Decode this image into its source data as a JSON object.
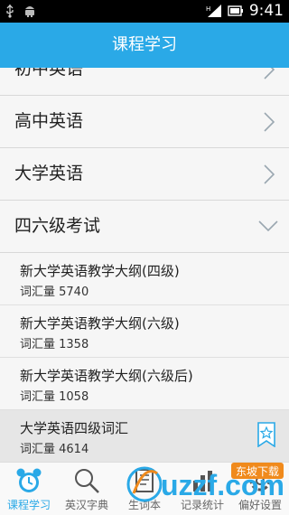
{
  "status_bar": {
    "time": "9:41"
  },
  "header": {
    "title": "课程学习"
  },
  "categories": [
    {
      "label": "初中英语",
      "state": "collapsed"
    },
    {
      "label": "高中英语",
      "state": "collapsed"
    },
    {
      "label": "大学英语",
      "state": "collapsed"
    },
    {
      "label": "四六级考试",
      "state": "expanded"
    }
  ],
  "sublist": [
    {
      "title": "新大学英语教学大纲(四级)",
      "count": "词汇量 5740"
    },
    {
      "title": "新大学英语教学大纲(六级)",
      "count": "词汇量 1358"
    },
    {
      "title": "新大学英语教学大纲(六级后)",
      "count": "词汇量 1058"
    },
    {
      "title": "大学英语四级词汇",
      "count": "词汇量 4614",
      "selected": true
    }
  ],
  "tabs": [
    {
      "label": "课程学习",
      "icon": "alarm-clock-icon",
      "active": true
    },
    {
      "label": "英汉字典",
      "icon": "magnifier-icon",
      "active": false
    },
    {
      "label": "生词本",
      "icon": "notebook-icon",
      "active": false
    },
    {
      "label": "记录统计",
      "icon": "stats-icon",
      "active": false
    },
    {
      "label": "偏好设置",
      "icon": "settings-icon",
      "active": false
    }
  ],
  "watermark": {
    "text": "uzzf.com",
    "badge": "东坡下载"
  },
  "colors": {
    "accent": "#2aa9e7",
    "watermark_orange": "#f08a1c"
  }
}
